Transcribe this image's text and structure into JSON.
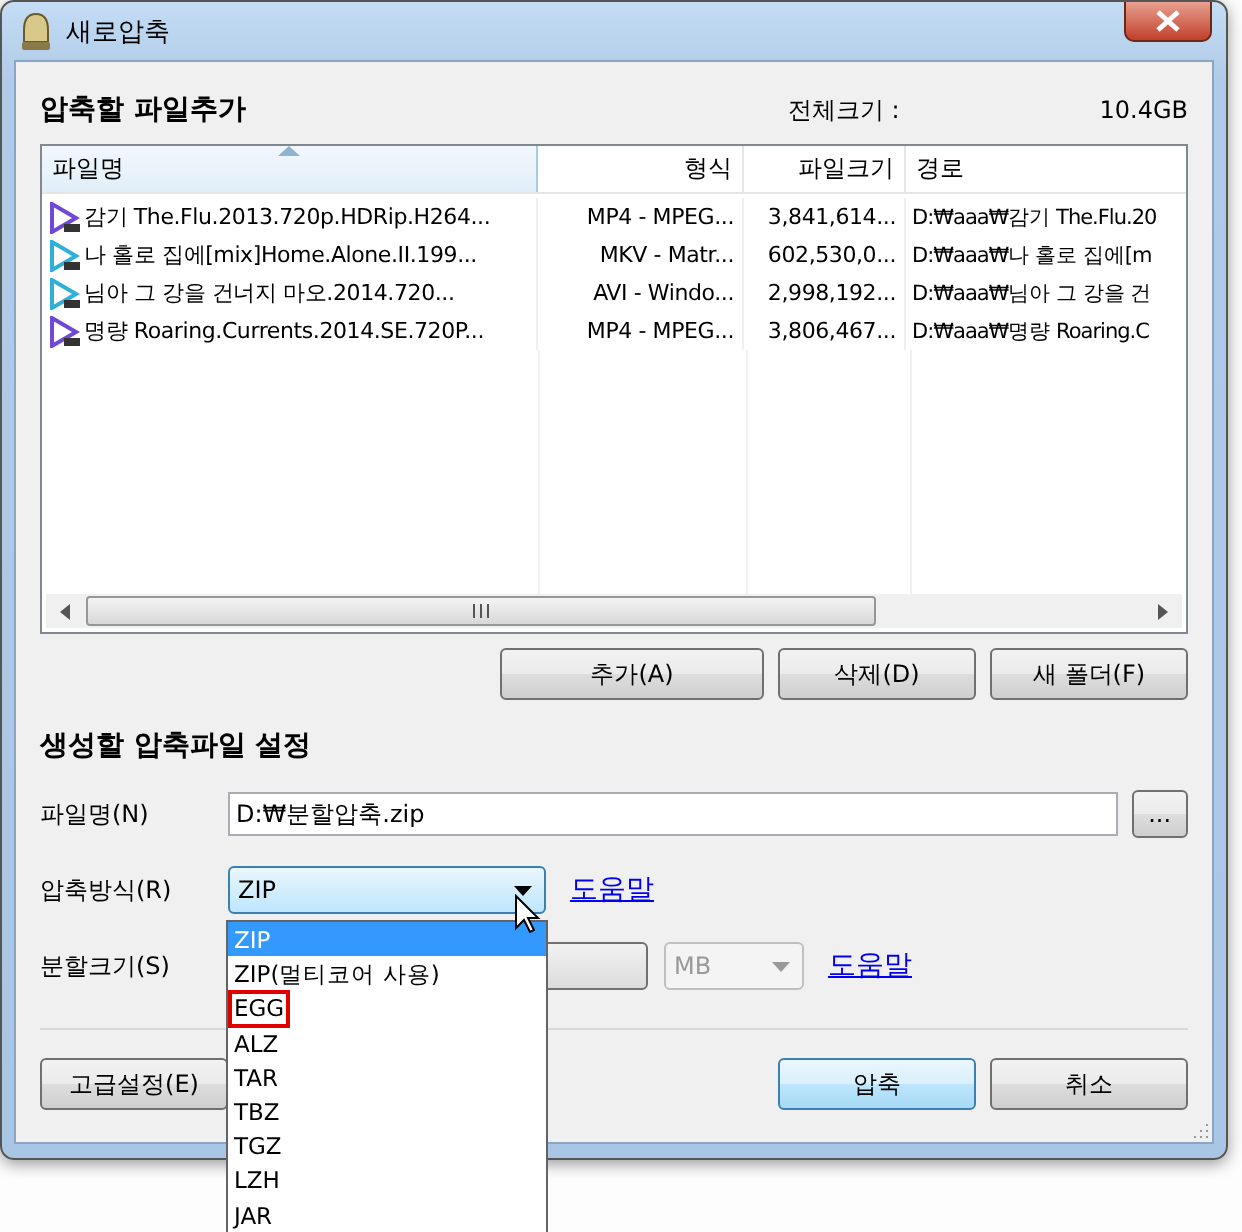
{
  "window": {
    "title": "새로압축"
  },
  "add_section": {
    "title": "압축할 파일추가",
    "total_label": "전체크기 :",
    "total_value": "10.4GB"
  },
  "table": {
    "columns": [
      {
        "label": "파일명",
        "sorted": true
      },
      {
        "label": "형식",
        "sorted": false
      },
      {
        "label": "파일크기",
        "sorted": false
      },
      {
        "label": "경로",
        "sorted": false
      }
    ],
    "rows": [
      {
        "name": "감기 The.Flu.2013.720p.HDRip.H264...",
        "format": "MP4 - MPEG...",
        "size": "3,841,614...",
        "path": "D:₩aaa₩감기 The.Flu.20",
        "color": "#7048d8"
      },
      {
        "name": "나 홀로 집에[mix]Home.Alone.II.199...",
        "format": "MKV - Matr...",
        "size": "602,530,0...",
        "path": "D:₩aaa₩나 홀로 집에[m",
        "color": "#30b0d8"
      },
      {
        "name": "님아 그 강을 건너지 마오.2014.720...",
        "format": "AVI - Windo...",
        "size": "2,998,192...",
        "path": "D:₩aaa₩님아 그 강을 건",
        "color": "#30b0d8"
      },
      {
        "name": "명량 Roaring.Currents.2014.SE.720P...",
        "format": "MP4 - MPEG...",
        "size": "3,806,467...",
        "path": "D:₩aaa₩명량 Roaring.C",
        "color": "#7048d8"
      }
    ]
  },
  "file_buttons": [
    "추가(A)",
    "삭제(D)",
    "새 폴더(F)"
  ],
  "settings": {
    "title": "생성할 압축파일 설정",
    "filename_label": "파일명(N)",
    "filename_value": "D:₩분할압축.zip",
    "browse": "...",
    "method_label": "압축방식(R)",
    "method_value": "ZIP",
    "method_help": "도움말",
    "split_label": "분할크기(S)",
    "unit": "MB",
    "unit_disabled": true,
    "split_help": "도움말"
  },
  "method_options": [
    {
      "label": "ZIP",
      "selected": true,
      "highlighted": false
    },
    {
      "label": "ZIP(멀티코어 사용)",
      "selected": false,
      "highlighted": false
    },
    {
      "label": "EGG",
      "selected": false,
      "highlighted": true
    },
    {
      "label": "ALZ",
      "selected": false,
      "highlighted": false
    },
    {
      "label": "TAR",
      "selected": false,
      "highlighted": false
    },
    {
      "label": "TBZ",
      "selected": false,
      "highlighted": false
    },
    {
      "label": "TGZ",
      "selected": false,
      "highlighted": false
    },
    {
      "label": "LZH",
      "selected": false,
      "highlighted": false
    },
    {
      "label": "JAR",
      "selected": false,
      "highlighted": false
    }
  ],
  "bottom_buttons": [
    {
      "label": "고급설정(E)",
      "default": false
    },
    {
      "label": "압축",
      "default": true
    },
    {
      "label": "취소",
      "default": false
    }
  ]
}
